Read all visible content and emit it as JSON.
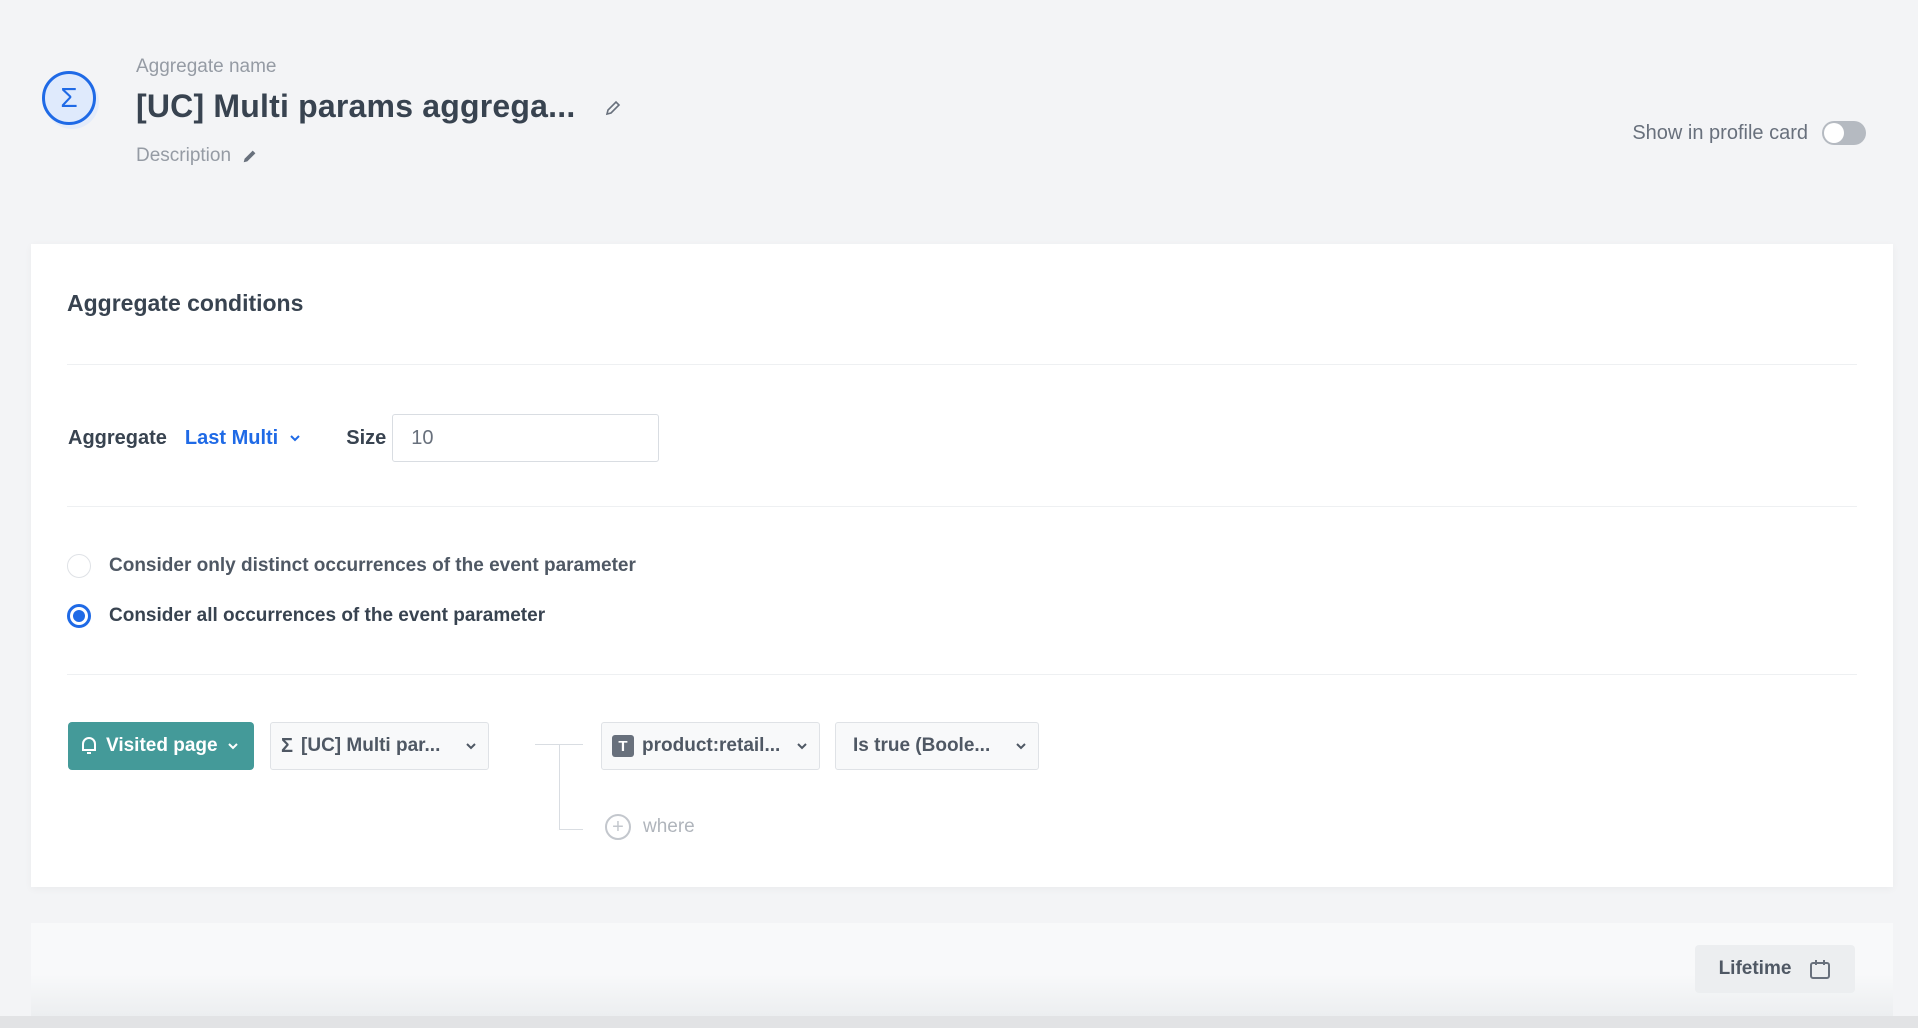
{
  "header": {
    "icon": "sigma-icon",
    "name_label": "Aggregate name",
    "name_value": "[UC] Multi params aggrega...",
    "description_label": "Description",
    "show_in_profile_label": "Show in profile card",
    "show_in_profile_enabled": false
  },
  "conditions": {
    "title": "Aggregate conditions",
    "aggregate_label": "Aggregate",
    "aggregate_value": "Last Multi",
    "size_label": "Size",
    "size_value": "10",
    "radio_options": [
      {
        "label": "Consider only distinct occurrences of the event parameter",
        "selected": false
      },
      {
        "label": "Consider all occurrences of the event parameter",
        "selected": true
      }
    ],
    "event_button": {
      "icon": "bell-icon",
      "label": "Visited page"
    },
    "param_dropdown": {
      "icon": "sigma-icon",
      "label": "[UC] Multi par..."
    },
    "filter_param_dropdown": {
      "icon": "text-type-icon",
      "icon_glyph": "T",
      "label": "product:retail..."
    },
    "operator_dropdown": {
      "label": "Is true (Boole..."
    },
    "where_label": "where"
  },
  "footer": {
    "lifetime_label": "Lifetime",
    "lifetime_icon": "calendar-icon"
  },
  "colors": {
    "accent": "#1f6ae6",
    "event_teal": "#449a99",
    "background": "#f3f4f6"
  }
}
